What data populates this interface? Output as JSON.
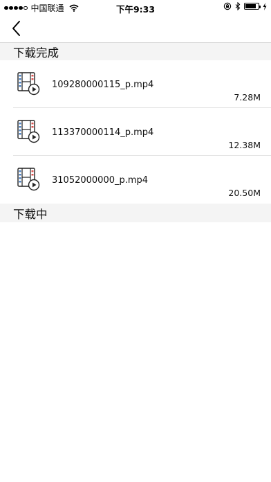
{
  "status_bar": {
    "carrier": "中国联通",
    "time": "下午9:33",
    "battery_level_percent": 85
  },
  "sections": {
    "completed": {
      "title": "下载完成"
    },
    "in_progress": {
      "title": "下载中"
    }
  },
  "downloads": [
    {
      "name": "109280000115_p.mp4",
      "size": "7.28M",
      "icon": "video-file-play-icon"
    },
    {
      "name": "113370000114_p.mp4",
      "size": "12.38M",
      "icon": "video-file-play-icon"
    },
    {
      "name": "31052000000_p.mp4",
      "size": "20.50M",
      "icon": "video-file-play-icon"
    }
  ],
  "icons": {
    "back": "chevron-left-icon",
    "wifi": "wifi-icon",
    "rotation_lock": "rotation-lock-icon",
    "bluetooth": "bluetooth-icon",
    "battery": "battery-icon",
    "charging": "charging-bolt-icon"
  },
  "colors": {
    "section_background": "#f4f4f4",
    "film_strip_red": "#d9534f",
    "film_strip_blue": "#4a7fc1"
  }
}
